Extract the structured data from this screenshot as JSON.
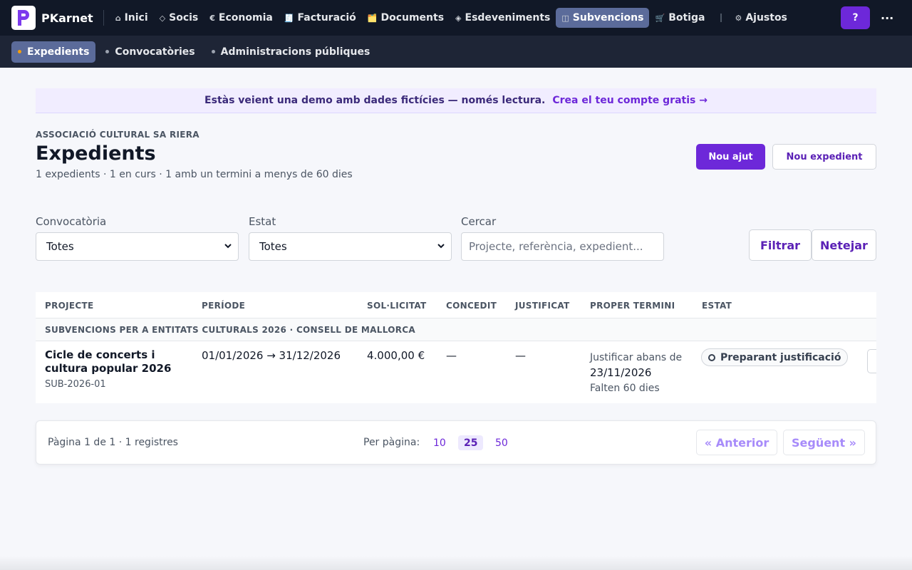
{
  "app": {
    "brand": "PKarnet"
  },
  "nav": {
    "items": [
      {
        "label": "Inici",
        "icon": "⌂"
      },
      {
        "label": "Socis",
        "icon": "◇"
      },
      {
        "label": "Economia",
        "icon": "€"
      },
      {
        "label": "Facturació",
        "icon": "🧾"
      },
      {
        "label": "Documents",
        "icon": "🗂️"
      },
      {
        "label": "Esdeveniments",
        "icon": "◈"
      },
      {
        "label": "Subvencions",
        "icon": "◫"
      },
      {
        "label": "Botiga",
        "icon": "🛒"
      }
    ],
    "settings": {
      "label": "Ajustos",
      "icon": "⚙"
    },
    "help_label": "?",
    "more_label": "..."
  },
  "subnav": {
    "items": [
      {
        "label": "Expedients"
      },
      {
        "label": "Convocatòries"
      },
      {
        "label": "Administracions públiques"
      }
    ]
  },
  "banner": {
    "message": "Estàs veient una demo amb dades fictícies — només lectura.",
    "cta": "Crea el teu compte gratis →"
  },
  "header": {
    "org": "ASSOCIACIÓ CULTURAL SA RIERA",
    "title": "Expedients",
    "summary": "1 expedients · 1 en curs · 1 amb un termini a menys de 60 dies",
    "new_aid_label": "Nou ajut",
    "new_file_label": "Nou expedient"
  },
  "filters": {
    "call_label": "Convocatòria",
    "call_value": "Totes",
    "status_label": "Estat",
    "status_value": "Totes",
    "search_label": "Cercar",
    "search_placeholder": "Projecte, referència, expedient...",
    "filter_label": "Filtrar",
    "clear_label": "Netejar"
  },
  "table": {
    "columns": [
      "PROJECTE",
      "PERÍODE",
      "SOL·LICITAT",
      "CONCEDIT",
      "JUSTIFICAT",
      "PROPER TERMINI",
      "ESTAT"
    ],
    "group": "SUBVENCIONS PER A ENTITATS CULTURALS 2026 · CONSELL DE MALLORCA",
    "rows": [
      {
        "project": "Cicle de concerts i cultura popular 2026",
        "ref": "SUB-2026-01",
        "period": "01/01/2026 → 31/12/2026",
        "requested": "4.000,00 €",
        "granted": "—",
        "justified": "—",
        "deadline_label": "Justificar abans de",
        "deadline_date": "23/11/2026",
        "deadline_remaining": "Falten 60 dies",
        "status": "Preparant justificació"
      }
    ]
  },
  "pagination": {
    "info": "Pàgina 1 de 1 · 1 registres",
    "per_page_label": "Per pàgina:",
    "sizes": [
      "10",
      "25",
      "50"
    ],
    "prev_label": "« Anterior",
    "next_label": "Següent »"
  },
  "colors": {
    "accent": "#6d28d9",
    "nav_bg": "#111827",
    "active_nav": "#5b6b9a"
  }
}
